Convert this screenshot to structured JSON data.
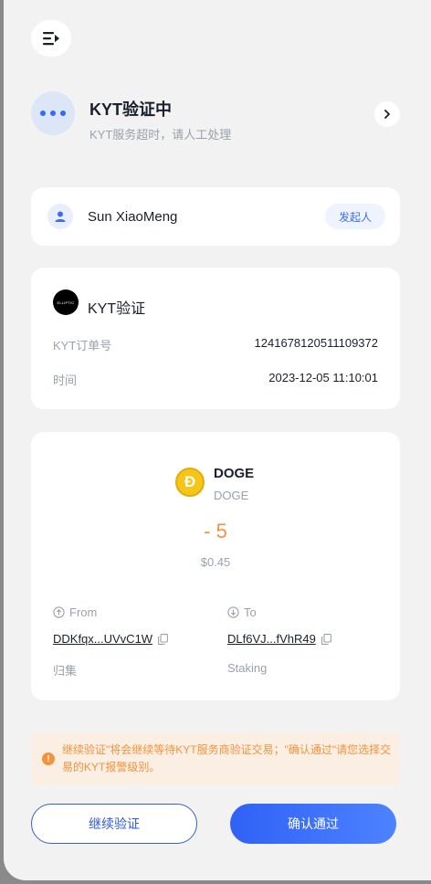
{
  "status": {
    "title": "KYT验证中",
    "subtitle": "KYT服务超时，请人工处理"
  },
  "initiator": {
    "name": "Sun XiaoMeng",
    "role_badge": "发起人"
  },
  "kyt": {
    "logo_text": "ELLIPTIC",
    "title": "KYT验证",
    "order_label": "KYT订单号",
    "order_value": "1241678120511109372",
    "time_label": "时间",
    "time_value": "2023-12-05 11:10:01"
  },
  "transaction": {
    "coin_symbol": "Ð",
    "coin_name": "DOGE",
    "coin_network": "DOGE",
    "amount": "- 5",
    "usd_value": "$0.45",
    "from": {
      "label": "From",
      "address": "DDKfqx...UVvC1W",
      "tag": "归集"
    },
    "to": {
      "label": "To",
      "address": "DLf6VJ...fVhR49",
      "tag": "Staking"
    }
  },
  "notice": {
    "text": "继续验证\"将会继续等待KYT服务商验证交易；\"确认通过\"请您选择交易的KYT报警级别。"
  },
  "actions": {
    "continue_label": "继续验证",
    "confirm_label": "确认通过"
  },
  "colors": {
    "accent": "#2f62f5",
    "warning": "#f5923e",
    "coin": "#f5c518"
  }
}
